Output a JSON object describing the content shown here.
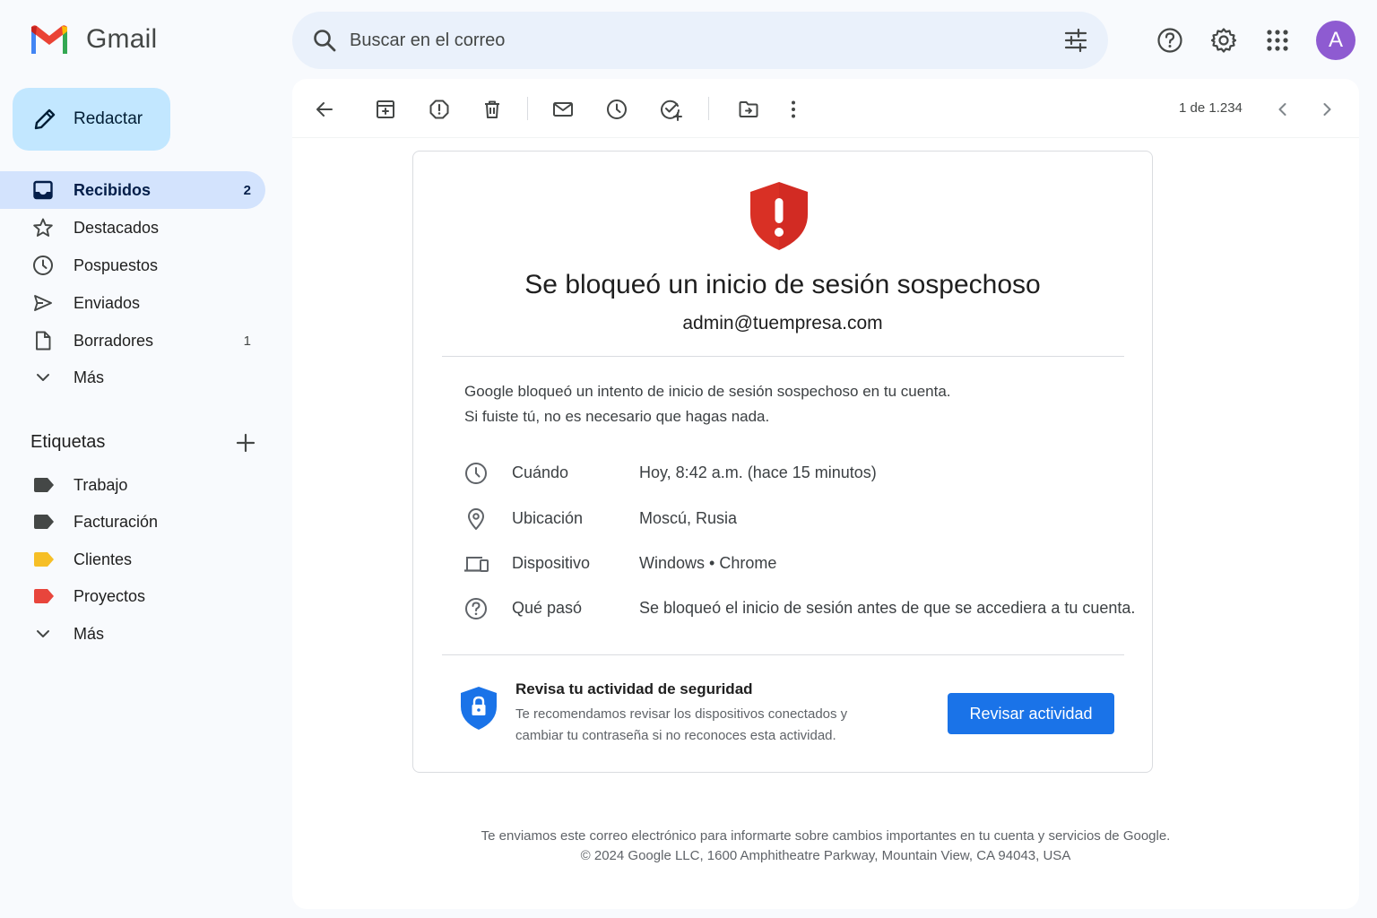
{
  "app": {
    "name": "Gmail",
    "brand_colors": [
      "#4285f4",
      "#ea4335",
      "#fbbc04",
      "#34a853"
    ]
  },
  "search": {
    "placeholder": "Buscar en el correo"
  },
  "header": {
    "icons": [
      "help-icon",
      "settings-icon",
      "apps-icon"
    ],
    "avatar_letter": "A",
    "avatar_color": "#8e5bd1"
  },
  "sidebar": {
    "compose_label": "Redactar",
    "items": [
      {
        "label": "Recibidos",
        "count": "2",
        "icon": "inbox-icon"
      },
      {
        "label": "Destacados",
        "count": "",
        "icon": "star-icon"
      },
      {
        "label": "Pospuestos",
        "count": "",
        "icon": "clock-icon"
      },
      {
        "label": "Enviados",
        "count": "",
        "icon": "send-icon"
      },
      {
        "label": "Borradores",
        "count": "1",
        "icon": "draft-icon"
      },
      {
        "label": "Más",
        "count": "",
        "icon": "chevron-down-icon"
      }
    ],
    "labels_title": "Etiquetas",
    "labels": [
      {
        "label": "Trabajo",
        "color": "#444746"
      },
      {
        "label": "Facturación",
        "color": "#444746"
      },
      {
        "label": "Clientes",
        "color": "#f6bf26"
      },
      {
        "label": "Proyectos",
        "color": "#e8453c"
      },
      {
        "label": "Más",
        "color": ""
      }
    ]
  },
  "toolbar": {
    "pager": "1 de 1.234",
    "icons": [
      "back-arrow-icon",
      "archive-icon",
      "report-spam-icon",
      "delete-icon",
      "mark-unread-icon",
      "snooze-icon",
      "add-task-icon",
      "move-to-icon",
      "more-vert-icon"
    ]
  },
  "email": {
    "title": "Se bloqueó un inicio de sesión sospechoso",
    "account": "admin@tuempresa.com",
    "intro_line1": "Google bloqueó un intento de inicio de sesión sospechoso en tu cuenta.",
    "intro_line2": "Si fuiste tú, no es necesario que hagas nada.",
    "details": [
      {
        "label": "Cuándo",
        "value": "Hoy, 8:42 a.m. (hace 15 minutos)",
        "icon": "clock-icon"
      },
      {
        "label": "Ubicación",
        "value": "Moscú, Rusia",
        "icon": "location-pin-icon"
      },
      {
        "label": "Dispositivo",
        "value": "Windows • Chrome",
        "icon": "devices-icon"
      },
      {
        "label": "Qué pasó",
        "value": "Se bloqueó el inicio de sesión antes de que se accediera a tu cuenta.",
        "icon": "help-circle-icon"
      }
    ],
    "review": {
      "title": "Revisa tu actividad de seguridad",
      "text_line1": "Te recomendamos revisar los dispositivos conectados y",
      "text_line2": "cambiar tu contraseña si no reconoces esta actividad.",
      "button": "Revisar actividad",
      "button_color": "#1a73e8"
    },
    "alert_color": "#d93025",
    "footer_line1": "Te enviamos este correo electrónico para informarte sobre cambios importantes en tu cuenta y servicios de Google.",
    "footer_line2": "© 2024 Google LLC, 1600 Amphitheatre Parkway, Mountain View, CA 94043, USA"
  }
}
